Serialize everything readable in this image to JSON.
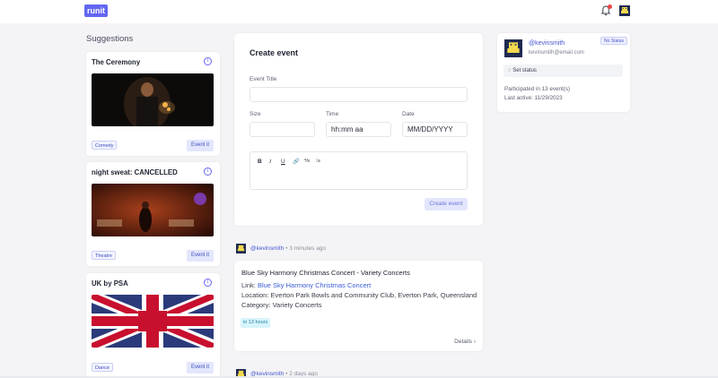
{
  "app": {
    "logo": "runit"
  },
  "topbar": {
    "bell_icon": "bell-icon",
    "avatar_icon": "pixel-avatar-icon"
  },
  "suggestions": {
    "title": "Suggestions",
    "items": [
      {
        "name": "The Ceremony",
        "category": "Comedy",
        "button": "Event it"
      },
      {
        "name": "night sweat: CANCELLED",
        "category": "Theatre",
        "button": "Event it"
      },
      {
        "name": "UK by PSA",
        "category": "Dance",
        "button": "Event it"
      }
    ]
  },
  "create_event": {
    "title": "Create event",
    "event_title_label": "Event Title",
    "event_title_value": "",
    "size_label": "Size",
    "size_value": "",
    "time_label": "Time",
    "time_value": "hh:mm aa",
    "date_label": "Date",
    "date_value": "MM/DD/YYYY",
    "toolbar": {
      "bold": "B",
      "italic": "I",
      "underline": "U",
      "link": "🔗",
      "ordered_list": "⅟≡",
      "bullet_list": "⁝≡"
    },
    "submit": "Create event"
  },
  "feed": {
    "posts": [
      {
        "user": "@kevinsmith",
        "when": "• 3 minutes ago",
        "title": "Blue Sky Harmony Christmas Concert - Variety Concerts",
        "link_label": "Link:",
        "link_text": "Blue Sky Harmony Christmas Concert",
        "location": "Location: Everton Park Bowls and Community Club, Everton Park, Queensland",
        "category": "Category: Variety Concerts",
        "badge": "in 13 hours",
        "details": "Details"
      },
      {
        "user": "@kevinsmith",
        "when": "• 2 days ago"
      }
    ]
  },
  "profile": {
    "username": "@kevinsmith",
    "email": "kevinsmith@email.com",
    "status_pill": "No Status",
    "set_status": "Set status",
    "participated": "Participated in 13 event(s)",
    "last_active": "Last active: 11/29/2023"
  },
  "colors": {
    "accent": "#6366f1",
    "link": "#3b5bd6",
    "background": "#f4f4f6"
  }
}
